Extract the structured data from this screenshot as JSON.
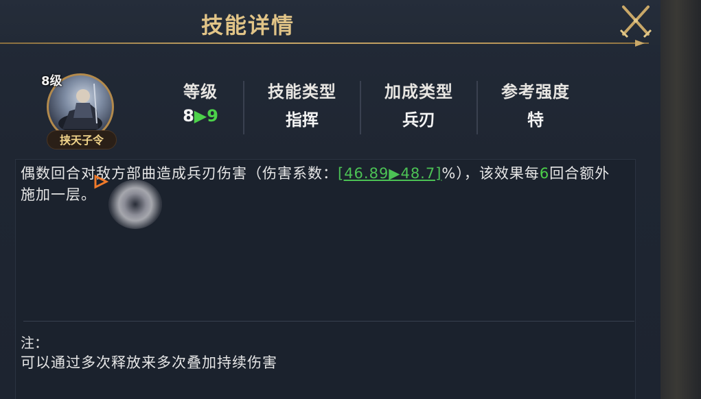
{
  "header": {
    "title": "技能详情"
  },
  "hero": {
    "level": "8级",
    "name": "挟天子令"
  },
  "stats": [
    {
      "label": "等级",
      "value_from": "8",
      "value_to": "9"
    },
    {
      "label": "技能类型",
      "value": "指挥"
    },
    {
      "label": "加成类型",
      "value": "兵刃"
    },
    {
      "label": "参考强度",
      "value": "特"
    }
  ],
  "description": {
    "part1": "偶数回合对敌方部曲造成兵刃伤害（伤害系数：",
    "coef": "[46.89▶48.7]",
    "part2": "%），该效果每",
    "rounds": "6",
    "part3": "回合额外施加一层。"
  },
  "note": {
    "label": "注：",
    "text": "可以通过多次释放来多次叠加持续伤害"
  },
  "colors": {
    "gold": "#e1c487",
    "green": "#4cd14a",
    "panel": "#1f2632"
  }
}
